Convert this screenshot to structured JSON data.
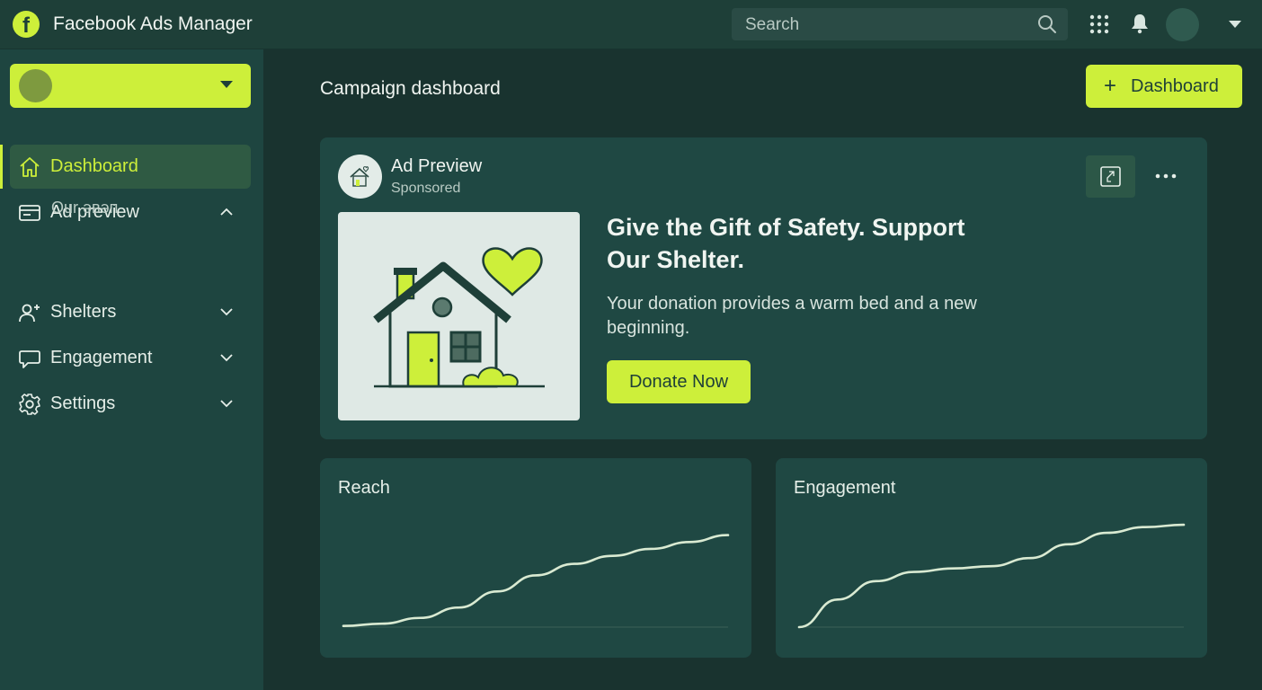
{
  "app": {
    "title": "Facebook Ads Manager",
    "logo_glyph": "f"
  },
  "search": {
    "placeholder": "Search"
  },
  "sidebar": {
    "items": [
      {
        "label": "Dashboard",
        "icon": "home-icon",
        "active": true
      },
      {
        "label": "Ad preview",
        "icon": "card-icon",
        "expanded": true,
        "children": [
          "Our әвәп"
        ]
      },
      {
        "label": "Shelters",
        "icon": "add-user-icon"
      },
      {
        "label": "Engagement",
        "icon": "chat-bubble-icon"
      },
      {
        "label": "Settings",
        "icon": "gear-icon"
      }
    ]
  },
  "main": {
    "page_title": "Campaign dashboard",
    "add_button": {
      "plus": "+",
      "label": "Dashboard"
    }
  },
  "ad": {
    "title": "Ad Preview",
    "subtitle": "Sponsored",
    "headline": "Give the Gift of Safety. Support Our Shelter.",
    "body": "Your donation provides a warm bed and a new beginning.",
    "cta": "Donate Now"
  },
  "charts": {
    "reach_title": "Reach",
    "engagement_title": "Engagement"
  },
  "chart_data": [
    {
      "type": "line",
      "title": "Reach",
      "x": [
        0,
        1,
        2,
        3,
        4,
        5,
        6,
        7,
        8,
        9,
        10
      ],
      "series": [
        {
          "values": [
            1,
            3,
            8,
            17,
            31,
            45,
            55,
            62,
            68,
            74,
            80
          ]
        }
      ],
      "ylim": [
        0,
        100
      ],
      "grid": false
    },
    {
      "type": "line",
      "title": "Engagement",
      "x": [
        0,
        1,
        2,
        3,
        4,
        5,
        6,
        7,
        8,
        9,
        10
      ],
      "series": [
        {
          "values": [
            0,
            24,
            40,
            48,
            51,
            53,
            60,
            72,
            82,
            87,
            89
          ]
        }
      ],
      "ylim": [
        0,
        100
      ],
      "grid": false
    }
  ],
  "colors": {
    "accent": "#cdef3a",
    "sidebar_bg": "#1e4540",
    "card_bg": "#1f4843",
    "line": "#d9ead2"
  }
}
